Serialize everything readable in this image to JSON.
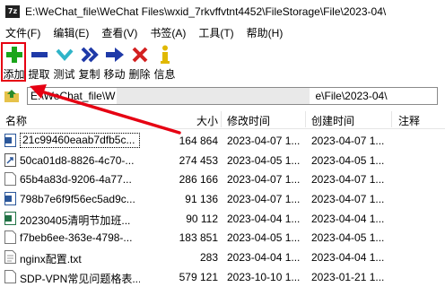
{
  "window": {
    "app_icon_text": "7z",
    "title": "E:\\WeChat_file\\WeChat Files\\wxid_7rkvffvtnt4452\\FileStorage\\File\\2023-04\\"
  },
  "menu": [
    "文件(F)",
    "编辑(E)",
    "查看(V)",
    "书签(A)",
    "工具(T)",
    "帮助(H)"
  ],
  "toolbar": {
    "items": [
      {
        "label": "添加",
        "icon": "plus-icon",
        "color": "#1aa51a"
      },
      {
        "label": "提取",
        "icon": "minus-icon",
        "color": "#1f3aa8"
      },
      {
        "label": "测试",
        "icon": "check-chevron-icon",
        "color": "#2fb4c8"
      },
      {
        "label": "复制",
        "icon": "double-arrow-icon",
        "color": "#1f3aa8"
      },
      {
        "label": "移动",
        "icon": "arrow-right-icon",
        "color": "#1f3aa8"
      },
      {
        "label": "删除",
        "icon": "x-icon",
        "color": "#d32020"
      },
      {
        "label": "信息",
        "icon": "info-icon",
        "color": "#e0b800"
      }
    ]
  },
  "address": {
    "left": "E:\\WeChat_file\\W",
    "right": "e\\File\\2023-04\\"
  },
  "columns": {
    "name": "名称",
    "size": "大小",
    "modified": "修改时间",
    "created": "创建时间",
    "comment": "注释"
  },
  "files": [
    {
      "name": "21c99460eaab7dfb5c...",
      "size": "164 864",
      "modified": "2023-04-07 1...",
      "created": "2023-04-07 1...",
      "icon": "word-icon"
    },
    {
      "name": "50ca01d8-8826-4c70-...",
      "size": "274 453",
      "modified": "2023-04-05 1...",
      "created": "2023-04-05 1...",
      "icon": "shortcut-icon"
    },
    {
      "name": "65b4a83d-9206-4a77...",
      "size": "286 166",
      "modified": "2023-04-07 1...",
      "created": "2023-04-07 1...",
      "icon": "file-icon"
    },
    {
      "name": "798b7e6f9f56ec5ad9c...",
      "size": "91 136",
      "modified": "2023-04-07 1...",
      "created": "2023-04-07 1...",
      "icon": "word-icon"
    },
    {
      "name": "20230405清明节加班...",
      "size": "90 112",
      "modified": "2023-04-04 1...",
      "created": "2023-04-04 1...",
      "icon": "excel-icon"
    },
    {
      "name": "f7beb6ee-363e-4798-...",
      "size": "183 851",
      "modified": "2023-04-05 1...",
      "created": "2023-04-05 1...",
      "icon": "file-icon"
    },
    {
      "name": "nginx配置.txt",
      "size": "283",
      "modified": "2023-04-04 1...",
      "created": "2023-04-04 1...",
      "icon": "text-icon"
    },
    {
      "name": "SDP-VPN常见问题格表...",
      "size": "579 121",
      "modified": "2023-10-10 1...",
      "created": "2023-01-21 1...",
      "icon": "file-icon"
    }
  ],
  "colors": {
    "highlight": "#e60012",
    "arrow": "#e60012"
  }
}
